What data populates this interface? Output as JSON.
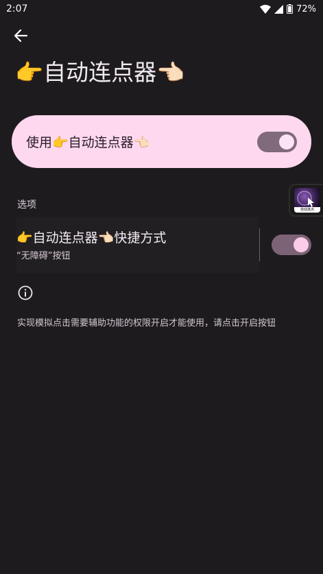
{
  "status_bar": {
    "time": "2:07",
    "battery": "72%",
    "icons": [
      "wifi-icon",
      "signal-icon",
      "battery-icon"
    ]
  },
  "header": {
    "back_icon": "arrow-left-icon",
    "title": "👉自动连点器👈🏻"
  },
  "main_switch": {
    "label": "使用👉自动连点器👈🏻",
    "enabled": true
  },
  "options": {
    "section_title": "选项",
    "shortcut": {
      "title": "👉自动连点器👈🏻快捷方式",
      "subtitle": "“无障碍”按钮",
      "enabled": true
    }
  },
  "floating_bubble": {
    "caption": "自动连点"
  },
  "info": {
    "icon": "info-icon",
    "text": "实现模拟点击需要辅助功能的权限开启才能使用，请点击开启按钮"
  },
  "colors": {
    "background": "#1e1b1f",
    "card": "#fdd8ee",
    "toggle_track": "#806a7b",
    "toggle_thumb": "#fde4f4"
  }
}
